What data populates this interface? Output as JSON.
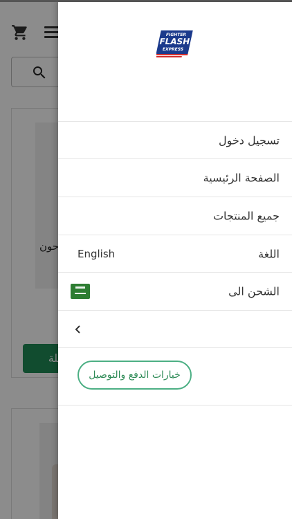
{
  "background": {
    "product_title_partial": "...حون",
    "product_button_partial": "سلة"
  },
  "drawer": {
    "logo": {
      "line1": "FIGHTER",
      "line2": "FLASH",
      "line3": "EXPRESS"
    },
    "menu": [
      {
        "label": "تسجيل دخول"
      },
      {
        "label": "الصفحة الرئيسية"
      },
      {
        "label": "جميع المنتجات"
      }
    ],
    "language": {
      "label": "اللغة",
      "value": "English"
    },
    "shipping": {
      "label": "الشحن الى",
      "flag": "saudi-arabia-flag"
    },
    "payment_button": "خيارات الدفع والتوصيل"
  },
  "colors": {
    "accent_green": "#1f8a57",
    "outline_green": "#4caf84",
    "logo_blue": "#1b3a8c",
    "logo_red": "#d32f2f"
  }
}
